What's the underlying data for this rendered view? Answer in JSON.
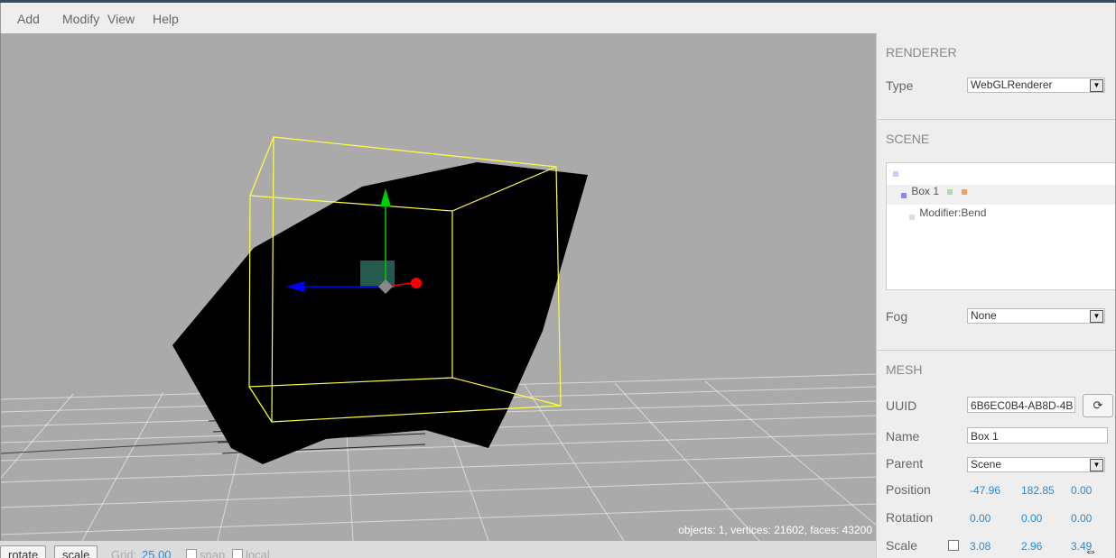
{
  "menu": {
    "add": "Add",
    "modify": "Modify",
    "view": "View",
    "help": "Help"
  },
  "viewport": {
    "info": "objects: 1, vertices: 21602, faces: 43200"
  },
  "toolbar": {
    "rotate": "rotate",
    "scale": "scale",
    "grid_label": "Grid:",
    "grid_value": "25.00",
    "snap_label": "snap",
    "local_label": "local"
  },
  "renderer": {
    "title": "RENDERER",
    "type_label": "Type",
    "type_value": "WebGLRenderer"
  },
  "scene": {
    "title": "SCENE",
    "items": [
      {
        "label": ""
      },
      {
        "label": "Box 1"
      },
      {
        "label": "Modifier:Bend"
      }
    ],
    "fog_label": "Fog",
    "fog_value": "None"
  },
  "mesh": {
    "title": "MESH",
    "uuid_label": "UUID",
    "uuid_value": "6B6EC0B4-AB8D-4B",
    "name_label": "Name",
    "name_value": "Box 1",
    "parent_label": "Parent",
    "parent_value": "Scene",
    "position_label": "Position",
    "position": [
      "-47.96",
      "182.85",
      "0.00"
    ],
    "rotation_label": "Rotation",
    "rotation": [
      "0.00",
      "0.00",
      "0.00"
    ],
    "scale_label": "Scale",
    "scale": [
      "3.08",
      "2.96",
      "3.49"
    ]
  },
  "colors": {
    "viewport_bg": "#aaaaaa",
    "selection_box": "#ffff44",
    "axis_x": "#ff0000",
    "axis_y": "#00cc00",
    "axis_z": "#0000ff",
    "link": "#2a8ad8"
  }
}
